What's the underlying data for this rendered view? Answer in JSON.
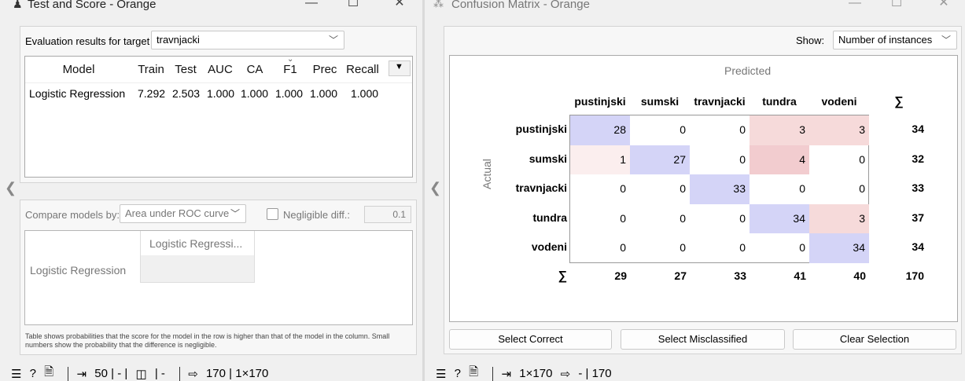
{
  "left": {
    "title": "Test and Score - Orange",
    "target_label": "Evaluation results for target",
    "target_value": "travnjacki",
    "columns": [
      "Model",
      "Train",
      "Test",
      "AUC",
      "CA",
      "F1",
      "Prec",
      "Recall"
    ],
    "row": [
      "Logistic Regression",
      "7.292",
      "2.503",
      "1.000",
      "1.000",
      "1.000",
      "1.000",
      "1.000"
    ],
    "compare_label": "Compare models by:",
    "compare_value": "Area under ROC curve",
    "negligible_label": "Negligible diff.:",
    "negligible_value": "0.1",
    "compare_col_header": "Logistic Regressi...",
    "compare_row_header": "Logistic Regression",
    "footnote": "Table shows probabilities that the score for the model in the row is higher than that of the model in the column. Small numbers show the probability that the difference is negligible.",
    "status": {
      "in": "50 | - | ",
      "mid": " | - ",
      "out": "170 | 1×170"
    }
  },
  "right": {
    "title": "Confusion Matrix - Orange",
    "show_label": "Show:",
    "show_value": "Number of instances",
    "predicted": "Predicted",
    "actual": "Actual",
    "sigma": "∑",
    "labels": [
      "pustinjski",
      "sumski",
      "travnjacki",
      "tundra",
      "vodeni"
    ],
    "matrix": [
      [
        "28",
        "0",
        "0",
        "3",
        "3"
      ],
      [
        "1",
        "27",
        "0",
        "4",
        "0"
      ],
      [
        "0",
        "0",
        "33",
        "0",
        "0"
      ],
      [
        "0",
        "0",
        "0",
        "34",
        "3"
      ],
      [
        "0",
        "0",
        "0",
        "0",
        "34"
      ]
    ],
    "row_sums": [
      "34",
      "32",
      "33",
      "37",
      "34"
    ],
    "col_sums": [
      "29",
      "27",
      "33",
      "41",
      "40"
    ],
    "total": "170",
    "buttons": {
      "correct": "Select Correct",
      "misclassified": "Select Misclassified",
      "clear": "Clear Selection"
    },
    "status": {
      "in": "1×170",
      "out": "- | 170"
    },
    "colors": {
      "diag": "#d4d4f7",
      "offdiag_strong": "#f2cccf",
      "offdiag_light": "#f6dada",
      "offdiag_faint": "#fbeeee"
    }
  }
}
